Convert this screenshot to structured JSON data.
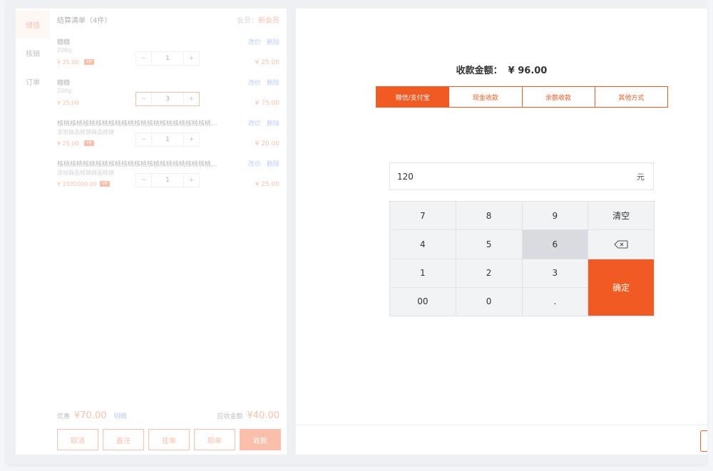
{
  "nav": [
    {
      "label": "储值",
      "active": true
    },
    {
      "label": "核销",
      "active": false
    },
    {
      "label": "订单",
      "active": false
    }
  ],
  "list": {
    "title": "结算清单（4件）",
    "member_label": "会员：",
    "member_value": "新会员"
  },
  "items": [
    {
      "name": "糖糖",
      "sub": "200g",
      "price": "¥ 25.00",
      "qty": "1",
      "sum": "¥ 25.00",
      "edit": "改价",
      "del": "删除",
      "vip": "VIP",
      "focus": false
    },
    {
      "name": "糖糖",
      "sub": "200g",
      "price": "¥ 25.00",
      "qty": "3",
      "sum": "¥ 75.00",
      "edit": "改价",
      "del": "删除",
      "vip": "",
      "focus": true
    },
    {
      "name": "核桃核桃核桃核桃核桃核桃核桃核桃核桃核桃核桃核桃...",
      "sub": "添加商品核销商品核销",
      "price": "¥ 25.00",
      "qty": "1",
      "sum": "¥ 20.00",
      "edit": "改价",
      "del": "删除",
      "vip": "VIP",
      "focus": false
    },
    {
      "name": "核桃核桃核桃核桃核桃核桃核桃核桃核桃核桃核桃核桃...",
      "sub": "添加商品核销商品核销",
      "price": "¥ 2500000.00",
      "qty": "1",
      "sum": "¥ 25.00",
      "edit": "改价",
      "del": "删除",
      "vip": "VIP",
      "focus": false
    }
  ],
  "summary": {
    "discount_label": "优惠",
    "discount_value": "¥70.00",
    "detail": "明细",
    "due_label": "应收金额",
    "due_value": "¥40.00"
  },
  "buttons": [
    "取消",
    "备注",
    "挂单",
    "取单",
    "收款"
  ],
  "checkout": {
    "amount_label": "收款金额：",
    "amount_value": "¥ 96.00",
    "tabs": [
      {
        "label": "微信/支付宝",
        "active": true
      },
      {
        "label": "现金收款",
        "active": false
      },
      {
        "label": "余额收款",
        "active": false
      },
      {
        "label": "其他方式",
        "active": false
      }
    ],
    "input_value": "120",
    "input_unit": "元"
  },
  "keypad": {
    "k7": "7",
    "k8": "8",
    "k9": "9",
    "clear": "清空",
    "k4": "4",
    "k5": "5",
    "k6": "6",
    "k1": "1",
    "k2": "2",
    "k3": "3",
    "confirm": "确定",
    "k00": "00",
    "k0": "0",
    "dot": "."
  },
  "colors": {
    "accent": "#f25a23",
    "link": "#4a7cf0"
  }
}
